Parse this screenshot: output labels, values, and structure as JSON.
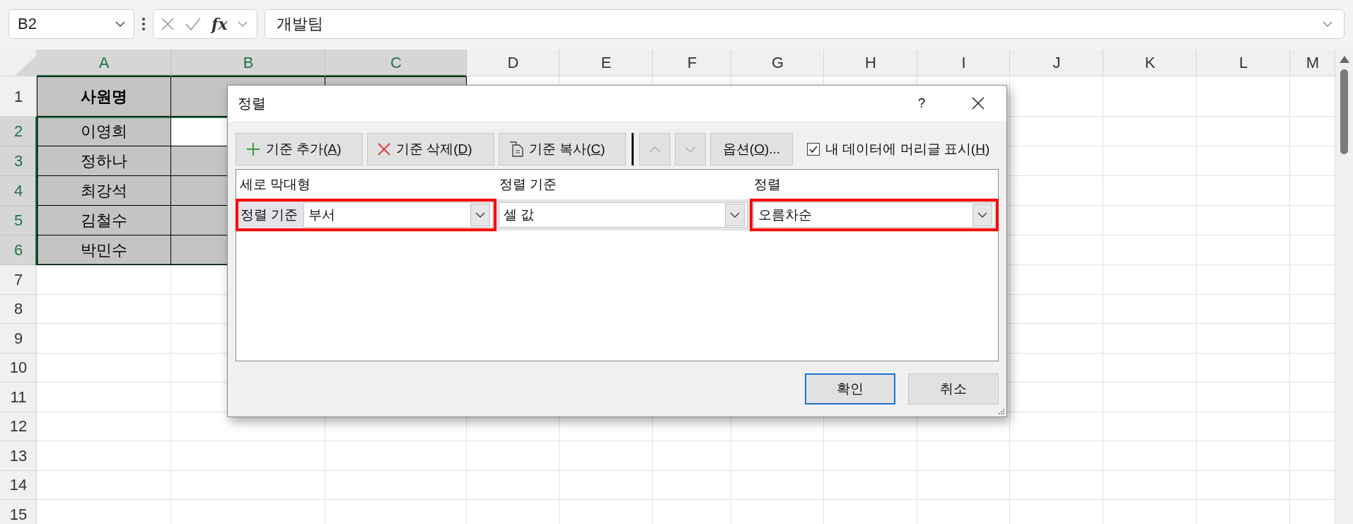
{
  "formula_bar": {
    "name_box": "B2",
    "function_label": "fx",
    "formula": "개발팀"
  },
  "sheet": {
    "columns": [
      {
        "label": "A",
        "selected": true
      },
      {
        "label": "B",
        "selected": true
      },
      {
        "label": "C",
        "selected": true
      },
      {
        "label": "D",
        "selected": false
      },
      {
        "label": "E",
        "selected": false
      },
      {
        "label": "F",
        "selected": false
      },
      {
        "label": "G",
        "selected": false
      },
      {
        "label": "H",
        "selected": false
      },
      {
        "label": "I",
        "selected": false
      },
      {
        "label": "J",
        "selected": false
      },
      {
        "label": "K",
        "selected": false
      },
      {
        "label": "L",
        "selected": false
      },
      {
        "label": "M",
        "selected": false
      }
    ],
    "rows": [
      {
        "number": "1",
        "selected": false,
        "cells": [
          {
            "text": "사원명",
            "bold": true,
            "shaded": true
          },
          {
            "shaded": true
          },
          {
            "shaded": true
          }
        ]
      },
      {
        "number": "2",
        "selected": true,
        "cells": [
          {
            "text": "이영희",
            "shaded": true
          },
          {
            "shaded": false
          },
          {}
        ]
      },
      {
        "number": "3",
        "selected": true,
        "cells": [
          {
            "text": "정하나",
            "shaded": true
          },
          {
            "shaded": true
          },
          {}
        ]
      },
      {
        "number": "4",
        "selected": true,
        "cells": [
          {
            "text": "최강석",
            "shaded": true
          },
          {
            "shaded": true
          },
          {}
        ]
      },
      {
        "number": "5",
        "selected": true,
        "cells": [
          {
            "text": "김철수",
            "shaded": true
          },
          {
            "shaded": true
          },
          {}
        ]
      },
      {
        "number": "6",
        "selected": true,
        "cells": [
          {
            "text": "박민수",
            "shaded": true
          },
          {
            "shaded": true
          },
          {}
        ]
      },
      {
        "number": "7",
        "selected": false
      },
      {
        "number": "8",
        "selected": false
      },
      {
        "number": "9",
        "selected": false
      },
      {
        "number": "10",
        "selected": false
      },
      {
        "number": "11",
        "selected": false
      },
      {
        "number": "12",
        "selected": false
      },
      {
        "number": "13",
        "selected": false
      },
      {
        "number": "14",
        "selected": false
      },
      {
        "number": "15",
        "selected": false
      }
    ]
  },
  "dialog": {
    "title": "정렬",
    "help": "?",
    "toolbar": [
      {
        "kind": "add",
        "label": "기준 추가(",
        "mnemonic": "A",
        "suffix": ")"
      },
      {
        "kind": "delete",
        "label": "기준 삭제(",
        "mnemonic": "D",
        "suffix": ")"
      },
      {
        "kind": "copy",
        "label": "기준 복사(",
        "mnemonic": "C",
        "suffix": ")"
      },
      {
        "kind": "up",
        "disabled": true
      },
      {
        "kind": "down",
        "disabled": true
      },
      {
        "kind": "options",
        "label": "옵션(",
        "mnemonic": "O",
        "suffix": ")..."
      }
    ],
    "header_checkbox": {
      "label": "내 데이터에 머리글 표시(",
      "mnemonic": "H",
      "suffix": ")",
      "checked": true
    },
    "columns": [
      "세로 막대형",
      "정렬 기준",
      "정렬"
    ],
    "levels": [
      {
        "label": "정렬 기준",
        "selected": true,
        "fields": [
          {
            "value": "부서",
            "highlighted": true
          },
          {
            "value": "셀 값",
            "highlighted": false
          },
          {
            "value": "오름차순",
            "highlighted": true
          }
        ]
      }
    ],
    "buttons": [
      {
        "label": "확인",
        "default": true
      },
      {
        "label": "취소",
        "default": false
      }
    ]
  }
}
